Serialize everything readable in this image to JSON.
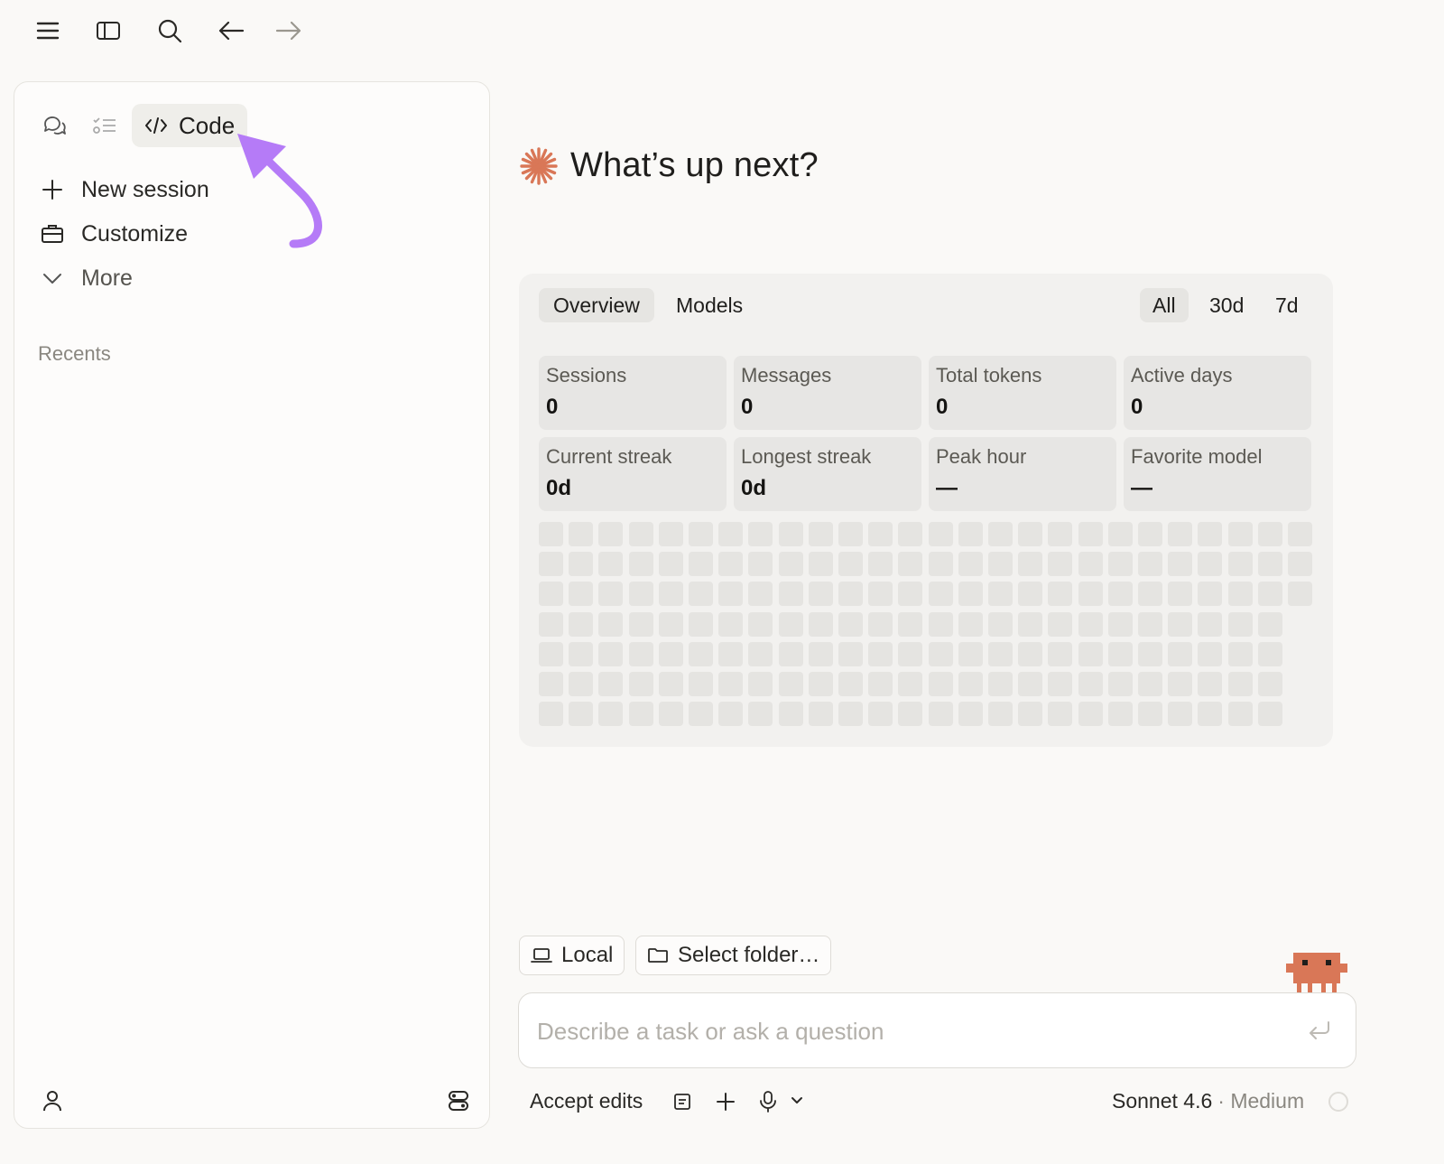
{
  "topbar": {
    "icons": [
      "menu-icon",
      "sidebar-toggle-icon",
      "search-icon",
      "arrow-left-icon",
      "arrow-right-icon"
    ]
  },
  "sidebar": {
    "mode_tabs": [
      {
        "icon": "chat-icon"
      },
      {
        "icon": "tasks-icon"
      },
      {
        "icon": "code-icon",
        "label": "Code",
        "active": true
      }
    ],
    "items": [
      {
        "icon": "plus-icon",
        "label": "New session"
      },
      {
        "icon": "briefcase-icon",
        "label": "Customize"
      },
      {
        "icon": "chevron-down-icon",
        "label": "More"
      }
    ],
    "recents_label": "Recents",
    "footer_icons": [
      "user-icon",
      "apps-icon"
    ]
  },
  "annotation": {
    "color": "#b57bf7",
    "icon": "curved-arrow-icon"
  },
  "main": {
    "headline": "What’s up next?",
    "accent_color": "#d97757",
    "stats": {
      "tabs": [
        {
          "label": "Overview",
          "active": true
        },
        {
          "label": "Models",
          "active": false
        }
      ],
      "ranges": [
        {
          "label": "All",
          "active": true
        },
        {
          "label": "30d",
          "active": false
        },
        {
          "label": "7d",
          "active": false
        }
      ],
      "cards": [
        {
          "label": "Sessions",
          "value": "0"
        },
        {
          "label": "Messages",
          "value": "0"
        },
        {
          "label": "Total tokens",
          "value": "0"
        },
        {
          "label": "Active days",
          "value": "0"
        },
        {
          "label": "Current streak",
          "value": "0d"
        },
        {
          "label": "Longest streak",
          "value": "0d"
        },
        {
          "label": "Peak hour",
          "value": "—"
        },
        {
          "label": "Favorite model",
          "value": "—"
        }
      ],
      "activity_grid": {
        "columns": 26,
        "rows": 7,
        "last_column_rows": 3
      }
    },
    "env_chips": [
      {
        "icon": "laptop-icon",
        "label": "Local"
      },
      {
        "icon": "folder-icon",
        "label": "Select folder…"
      }
    ],
    "composer": {
      "placeholder": "Describe a task or ask a question",
      "value": ""
    },
    "footer": {
      "permission_mode": "Accept edits",
      "model": "Sonnet 4.6",
      "effort": "· Medium"
    }
  }
}
